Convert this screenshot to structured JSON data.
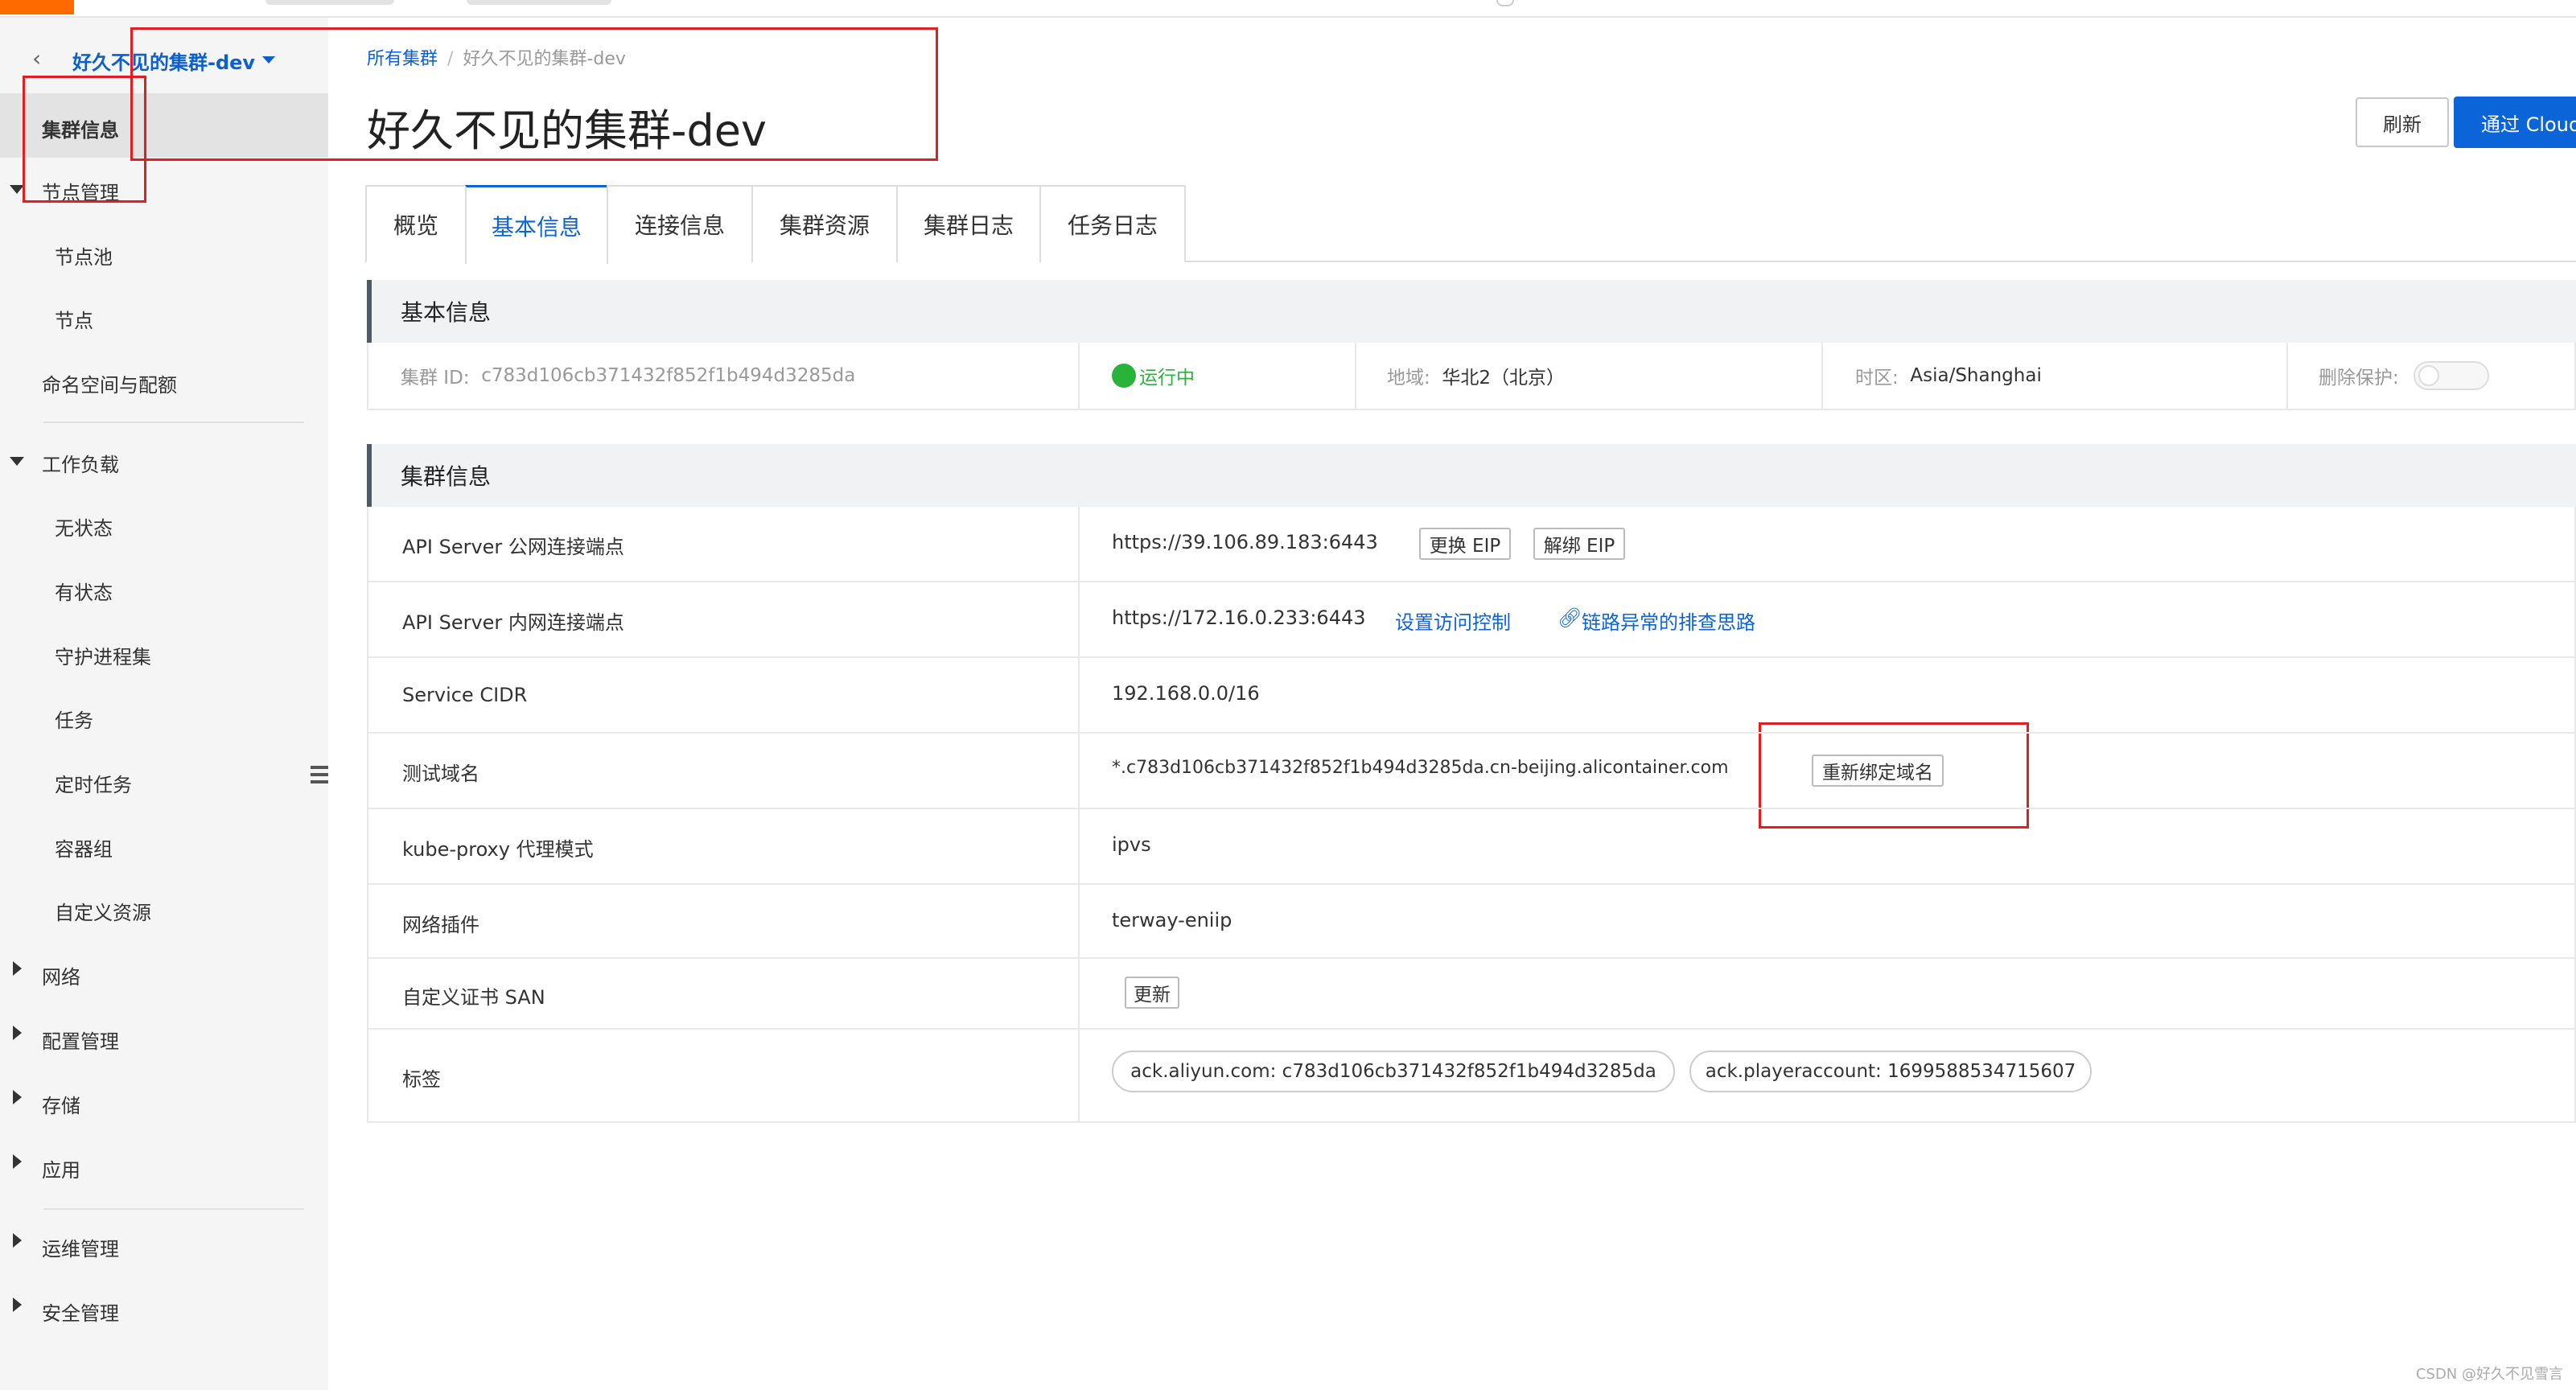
{
  "sidebar": {
    "back_icon": "chevron-left-icon",
    "cluster_name": "好久不见的集群-dev",
    "items": {
      "cluster_info": "集群信息",
      "node_mgmt": "节点管理",
      "node_pool": "节点池",
      "node": "节点",
      "namespace_quota": "命名空间与配额",
      "workload": "工作负载",
      "stateless": "无状态",
      "stateful": "有状态",
      "daemonset": "守护进程集",
      "job": "任务",
      "cronjob": "定时任务",
      "pod": "容器组",
      "crd": "自定义资源",
      "network": "网络",
      "config": "配置管理",
      "storage": "存储",
      "app": "应用",
      "ops": "运维管理",
      "security": "安全管理"
    }
  },
  "header": {
    "breadcrumb_root": "所有集群",
    "breadcrumb_sep": "/",
    "breadcrumb_current": "好久不见的集群-dev",
    "title": "好久不见的集群-dev",
    "refresh_label": "刷新",
    "primary_label": "通过 Cloud"
  },
  "tabs": {
    "overview": "概览",
    "basic": "基本信息",
    "connect": "连接信息",
    "resources": "集群资源",
    "cluster_log": "集群日志",
    "task_log": "任务日志"
  },
  "basic": {
    "title": "基本信息",
    "cluster_id_label": "集群 ID:",
    "cluster_id": "c783d106cb371432f852f1b494d3285da",
    "status": "运行中",
    "region_label": "地域:",
    "region": "华北2（北京）",
    "timezone_label": "时区:",
    "timezone": "Asia/Shanghai",
    "delete_protect_label": "删除保护:",
    "delete_protect_on": false
  },
  "cluster": {
    "title": "集群信息",
    "rows": {
      "api_public_key": "API Server 公网连接端点",
      "api_public_val": "https://39.106.89.183:6443",
      "change_eip": "更换 EIP",
      "unbind_eip": "解绑 EIP",
      "api_private_key": "API Server 内网连接端点",
      "api_private_val": "https://172.16.0.233:6443",
      "access_control": "设置访问控制",
      "troubleshoot": "链路异常的排查思路",
      "service_cidr_key": "Service CIDR",
      "service_cidr_val": "192.168.0.0/16",
      "test_domain_key": "测试域名",
      "test_domain_val": "*.c783d106cb371432f852f1b494d3285da.cn-beijing.alicontainer.com",
      "rebind_domain": "重新绑定域名",
      "kube_proxy_key": "kube-proxy 代理模式",
      "kube_proxy_val": "ipvs",
      "network_plugin_key": "网络插件",
      "network_plugin_val": "terway-eniip",
      "cert_san_key": "自定义证书 SAN",
      "cert_san_update": "更新",
      "tags_key": "标签",
      "tag1": "ack.aliyun.com: c783d106cb371432f852f1b494d3285da",
      "tag2": "ack.playeraccount: 1699588534715607"
    }
  },
  "watermark": "CSDN @好久不见雪言",
  "colors": {
    "accent": "#0b64d8",
    "status_running": "#2ab33b",
    "annotation_red": "#e02020"
  }
}
